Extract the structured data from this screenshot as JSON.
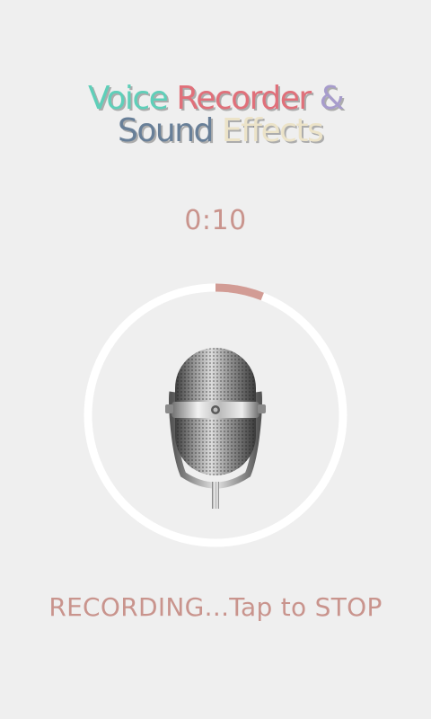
{
  "app": {
    "logo": {
      "line1": [
        {
          "text": "Voice",
          "color": "#5fcfb9"
        },
        {
          "text": "Recorder",
          "color": "#e0707a"
        },
        {
          "text": "&",
          "color": "#a79ccc"
        }
      ],
      "line2": [
        {
          "text": "Sound",
          "color": "#687f98"
        },
        {
          "text": "Effects",
          "color": "#ece3c8"
        }
      ]
    }
  },
  "recorder": {
    "elapsed": "0:10",
    "progress_fraction": 0.06,
    "status_text": "RECORDING...Tap to STOP",
    "accent_color": "#d29c95",
    "ring_color": "#ffffff",
    "icon": "microphone-icon"
  }
}
